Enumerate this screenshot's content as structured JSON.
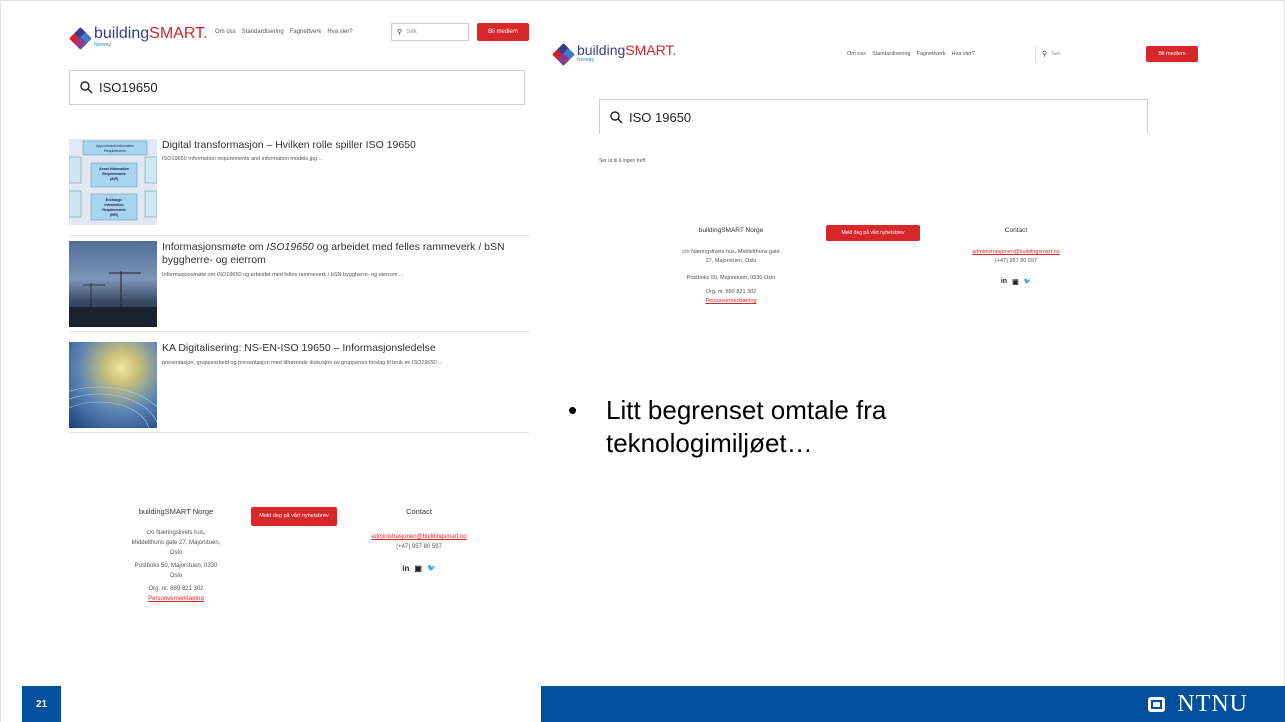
{
  "left": {
    "logo": {
      "word1": "building",
      "word2": "SMART.",
      "sub": "Norway"
    },
    "nav": [
      "Om oss",
      "Standardisering",
      "Fagnettverk",
      "Hva sier?"
    ],
    "search_placeholder": "Søk",
    "member_button": "Bli medlem",
    "query": "ISO19650",
    "results": [
      {
        "title": "Digital transformasjon – Hvilken rolle spiller ISO 19650",
        "desc": "ISO19650 Information requirements and information models.jpg ..."
      },
      {
        "title_pre": "Informasjonsmøte om ",
        "title_em": "ISO19650",
        "title_post": " og arbeidet med felles rammeverk / bSN byggherre- og eierrom",
        "desc_pre": "Informasjonsmøte om ",
        "desc_em": "ISO19650",
        "desc_post": " og arbeidet med felles rammeverk / bSN byggherre- og eierrom ..."
      },
      {
        "title": "KA Digitalisering: NS-EN-ISO 19650 – Informasjonsledelse",
        "desc_pre": "presentasjon, gruppearbeid og presentasjon med tilhørende diskusjon av gruppenes forslag til bruk av ",
        "desc_em": "ISO19650",
        "desc_post": " ..."
      }
    ],
    "thumb1": {
      "lines": [
        "Appointment Information",
        "Requirements",
        "Asset Information",
        "Requirements",
        "(AIR)",
        "Exchange",
        "Information",
        "Requirements",
        "(EIR)"
      ]
    },
    "footer": {
      "org": "buildingSMART Norge",
      "address": [
        "c/o Næringslivets hus,",
        "Middelthuns gate 27, Majorstuen,",
        "Oslo"
      ],
      "postbox": [
        "Postboks 50, Majorstuen, 0330",
        "Oslo"
      ],
      "orgnr": "Org. nr. 889 821 302",
      "privacy": "Personvernerklæring",
      "newsletter_button": "Meld deg på vårt nyhetsbrev",
      "contact_heading": "Contact",
      "email": "administrasjonen@buildingsmart.no",
      "phone": "(+47) 957 80 597",
      "social": [
        "in",
        "▣",
        "🐦"
      ]
    }
  },
  "right": {
    "logo": {
      "word1": "building",
      "word2": "SMART.",
      "sub": "Norway"
    },
    "nav": [
      "Om oss",
      "Standardisering",
      "Fagnettverk",
      "Hva sier?"
    ],
    "search_placeholder": "Søk",
    "member_button": "Bli medlem",
    "query": "ISO 19650",
    "no_results": "Ser ut til å ingen treff.",
    "footer": {
      "org": "buildingSMART Norge",
      "address": [
        "c/o Næringslivets hus, Middelthuns gate",
        "27, Majorstuen, Oslo"
      ],
      "postbox": "Postboks 50, Majorstuen, 0330 Oslo",
      "orgnr": "Org. nr. 889 821 302",
      "privacy": "Personvernerklæring",
      "newsletter_button": "Meld deg på vårt nyhetsbrev",
      "contact_heading": "Contact",
      "email": "administrasjonen@buildingsmart.no",
      "phone": "(+47) 957 80 597",
      "social": [
        "in",
        "▣",
        "🐦"
      ]
    }
  },
  "bullet": [
    "Litt begrenset omtale fra",
    "teknologimiljøet…"
  ],
  "slide_number": "21",
  "brand": "NTNU",
  "colors": {
    "accent_red": "#d8272a",
    "ntnu_blue": "#00509e"
  }
}
